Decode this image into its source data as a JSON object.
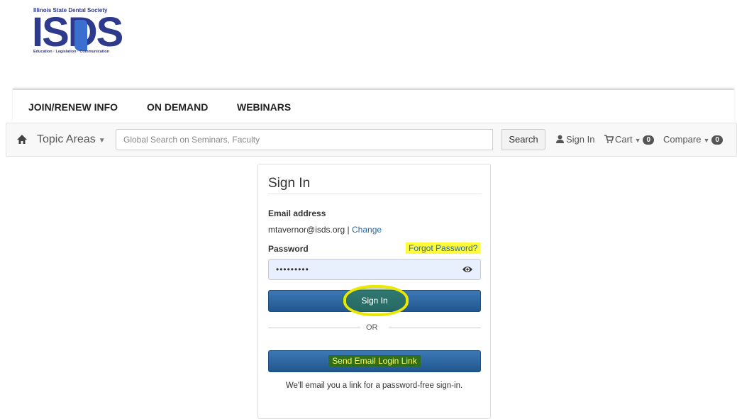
{
  "logo": {
    "org_name": "Illinois State Dental Society",
    "mark": "ISDS",
    "tagline": "Education · Legislation · Communication"
  },
  "topnav": {
    "items": [
      "JOIN/RENEW INFO",
      "ON DEMAND",
      "WEBINARS"
    ]
  },
  "navbar": {
    "topic_areas": "Topic Areas",
    "search_placeholder": "Global Search on Seminars, Faculty",
    "search_button": "Search",
    "sign_in": "Sign In",
    "cart": "Cart",
    "cart_count": "0",
    "compare": "Compare",
    "compare_count": "0"
  },
  "signin": {
    "title": "Sign In",
    "email_label": "Email address",
    "email_value": "mtavernor@isds.org",
    "separator": " | ",
    "change_link": "Change",
    "password_label": "Password",
    "forgot_link": "Forgot Password?",
    "password_mask": "•••••••••",
    "signin_button": "Sign In",
    "or_text": "OR",
    "send_link_button": "Send Email Login Link",
    "note": "We'll email you a link for a password-free sign-in."
  },
  "colors": {
    "brand": "#2e3a8c",
    "button_blue": "#2a66a3",
    "highlight_yellow": "#fffa3a",
    "link": "#2a6aa8"
  }
}
